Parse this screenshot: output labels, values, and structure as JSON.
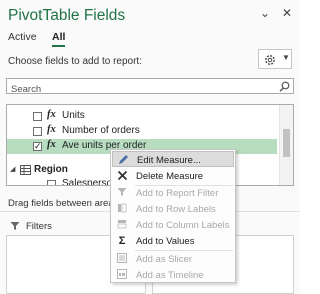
{
  "header": {
    "title": "PivotTable Fields",
    "close_glyph": "✕",
    "dropdown_glyph": "⌄"
  },
  "tabs": [
    {
      "label": "Active",
      "active": false
    },
    {
      "label": "All",
      "active": true
    }
  ],
  "choose_label": "Choose fields to add to report:",
  "search": {
    "placeholder": "Search"
  },
  "fields": [
    {
      "label": "Units",
      "checked": false,
      "type": "measure"
    },
    {
      "label": "Number of orders",
      "checked": false,
      "type": "measure"
    },
    {
      "label": "Ave units per order",
      "checked": true,
      "type": "measure",
      "selected": true
    }
  ],
  "table_group": {
    "label": "Region",
    "expand_glyph": "◢"
  },
  "partial_field": "Salesperson",
  "fx_glyph": "fx",
  "drag_text": "Drag fields between areas b",
  "areas": {
    "filters_label": "Filters"
  },
  "context_menu": {
    "items": [
      {
        "label": "Edit Measure...",
        "icon": "pencil-icon",
        "enabled": true,
        "hover": true
      },
      {
        "label": "Delete Measure",
        "icon": "delete-x-icon",
        "enabled": true
      },
      {
        "label": "Add to Report Filter",
        "icon": "filter-icon",
        "enabled": false
      },
      {
        "label": "Add to Row Labels",
        "icon": "rows-icon",
        "enabled": false
      },
      {
        "label": "Add to Column Labels",
        "icon": "columns-icon",
        "enabled": false
      },
      {
        "label": "Add to Values",
        "icon": "sigma-icon",
        "enabled": true
      },
      {
        "label": "Add as Slicer",
        "icon": "slicer-icon",
        "enabled": false
      },
      {
        "label": "Add as Timeline",
        "icon": "timeline-icon",
        "enabled": false
      }
    ]
  },
  "colors": {
    "accent": "#217346",
    "selected_row": "#b7dcbf",
    "disabled_text": "#a8a8a8"
  }
}
